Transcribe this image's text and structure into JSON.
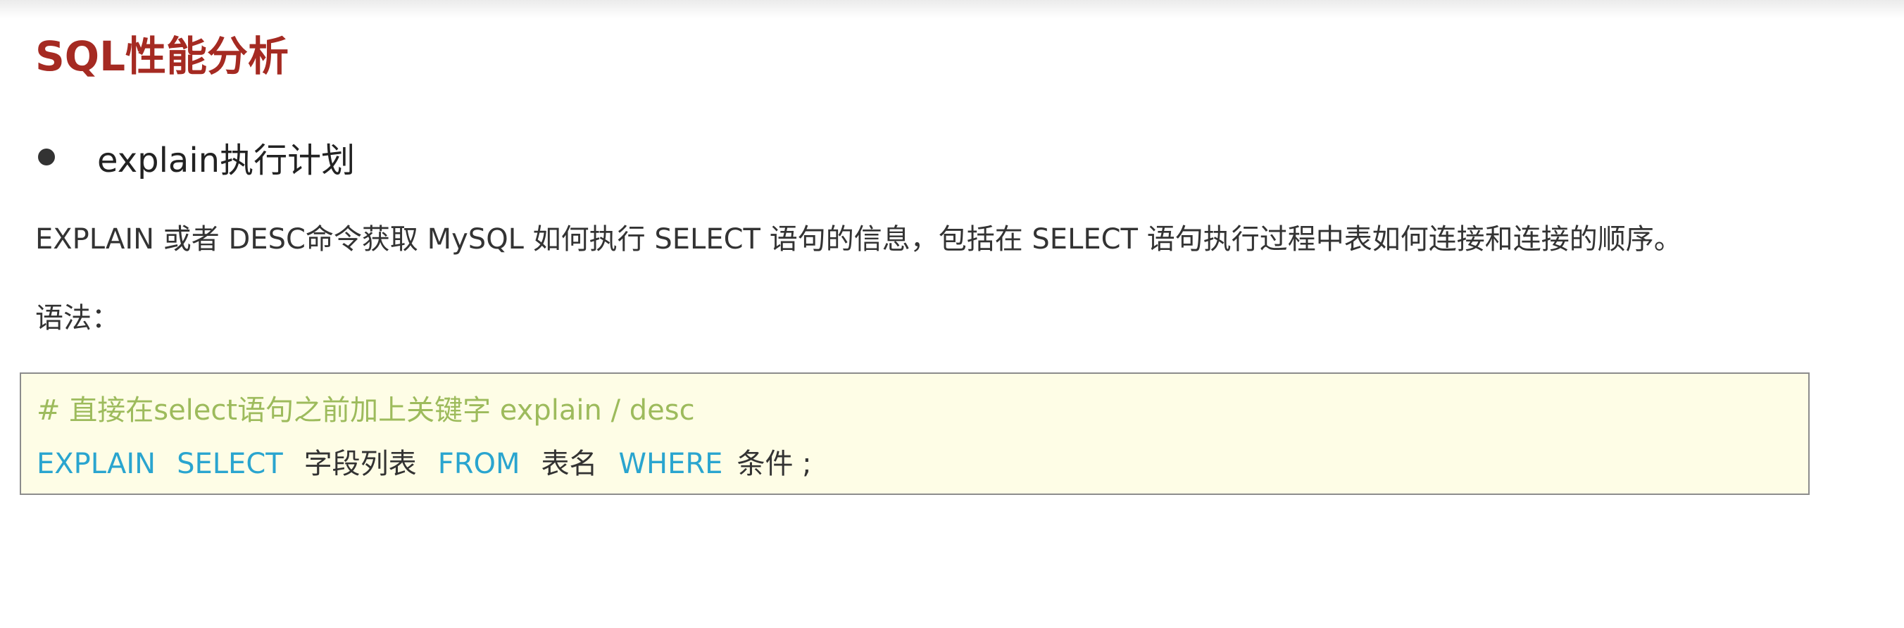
{
  "title": "SQL性能分析",
  "bullet": {
    "text": "explain执行计划"
  },
  "description": "EXPLAIN 或者 DESC命令获取 MySQL 如何执行 SELECT 语句的信息，包括在 SELECT 语句执行过程中表如何连接和连接的顺序。",
  "syntax_label": "语法：",
  "code": {
    "comment": "# 直接在select语句之前加上关键字 explain / desc",
    "tokens": {
      "explain": "EXPLAIN",
      "select": "SELECT",
      "fields": "字段列表",
      "from": "FROM",
      "table": "表名",
      "where": "WHERE",
      "condition": "条件 ;"
    }
  },
  "colors": {
    "title": "#a52a22",
    "keyword": "#2aa5cf",
    "comment": "#9dbb5c",
    "code_background": "#fefde6"
  }
}
